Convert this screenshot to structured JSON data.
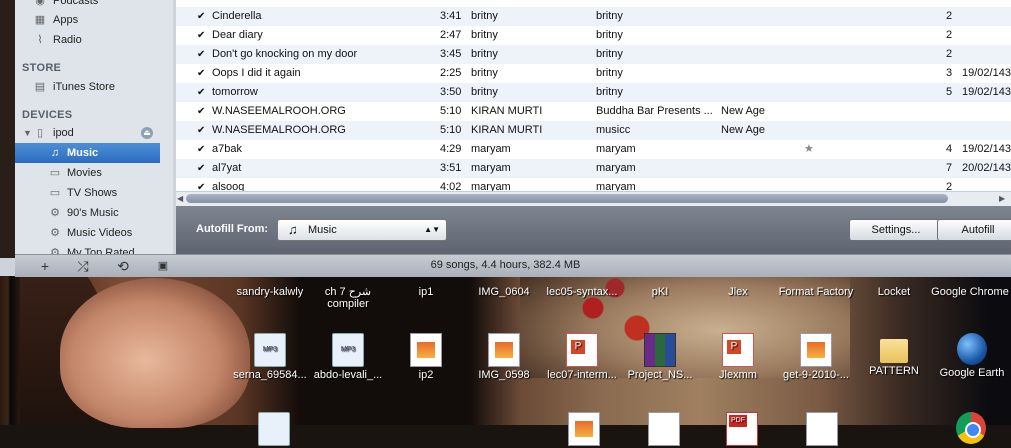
{
  "sidebar": {
    "top_items": [
      {
        "label": "Podcasts",
        "icon": "podcast-icon"
      },
      {
        "label": "Apps",
        "icon": "apps-icon"
      },
      {
        "label": "Radio",
        "icon": "radio-icon"
      }
    ],
    "store_heading": "STORE",
    "store_items": [
      {
        "label": "iTunes Store",
        "icon": "store-icon"
      }
    ],
    "devices_heading": "DEVICES",
    "device": {
      "label": "ipod",
      "icon": "ipod-icon"
    },
    "device_items": [
      {
        "label": "Music",
        "icon": "music-note-icon",
        "selected": true
      },
      {
        "label": "Movies",
        "icon": "movies-icon"
      },
      {
        "label": "TV Shows",
        "icon": "tv-icon"
      },
      {
        "label": "90's Music",
        "icon": "gear-icon"
      },
      {
        "label": "Music Videos",
        "icon": "gear-icon"
      },
      {
        "label": "My Top Rated",
        "icon": "gear-icon"
      }
    ]
  },
  "songs": [
    {
      "checked": "✔",
      "name": "Cinderella",
      "time": "3:41",
      "artist": "britny",
      "album": "britny",
      "genre": "",
      "rating": "",
      "plays": "2",
      "date": ""
    },
    {
      "checked": "✔",
      "name": "Dear diary",
      "time": "2:47",
      "artist": "britny",
      "album": "britny",
      "genre": "",
      "rating": "",
      "plays": "2",
      "date": ""
    },
    {
      "checked": "✔",
      "name": "Don't go knocking on my door",
      "time": "3:45",
      "artist": "britny",
      "album": "britny",
      "genre": "",
      "rating": "",
      "plays": "2",
      "date": ""
    },
    {
      "checked": "✔",
      "name": "Oops I did it again",
      "time": "2:25",
      "artist": "britny",
      "album": "britny",
      "genre": "",
      "rating": "",
      "plays": "3",
      "date": "19/02/143"
    },
    {
      "checked": "✔",
      "name": "tomorrow",
      "time": "3:50",
      "artist": "britny",
      "album": "britny",
      "genre": "",
      "rating": "",
      "plays": "5",
      "date": "19/02/143"
    },
    {
      "checked": "✔",
      "name": "W.NASEEMALROOH.ORG",
      "time": "5:10",
      "artist": "KIRAN MURTI",
      "album": "Buddha Bar Presents ...",
      "genre": "New Age",
      "rating": "",
      "plays": "",
      "date": ""
    },
    {
      "checked": "✔",
      "name": "W.NASEEMALROOH.ORG",
      "time": "5:10",
      "artist": "KIRAN MURTI",
      "album": "musicc",
      "genre": "New Age",
      "rating": "",
      "plays": "",
      "date": ""
    },
    {
      "checked": "✔",
      "name": "a7bak",
      "time": "4:29",
      "artist": "maryam",
      "album": "maryam",
      "genre": "",
      "rating": "★",
      "plays": "4",
      "date": "19/02/143"
    },
    {
      "checked": "✔",
      "name": "al7yat",
      "time": "3:51",
      "artist": "maryam",
      "album": "maryam",
      "genre": "",
      "rating": "",
      "plays": "7",
      "date": "20/02/143"
    },
    {
      "checked": "✔",
      "name": "alsoog",
      "time": "4:02",
      "artist": "maryam",
      "album": "maryam",
      "genre": "",
      "rating": "",
      "plays": "2",
      "date": ""
    }
  ],
  "autofill": {
    "label": "Autofill From:",
    "source": "Music",
    "settings_button": "Settings...",
    "autofill_button": "Autofill"
  },
  "status": {
    "summary": "69 songs, 4.4 hours, 382.4 MB"
  },
  "desktop_icons_row1": [
    "sandry-kalwly",
    "ch 7 شرح compiler",
    "ip1",
    "IMG_0604",
    "lec05-syntax...",
    "pKI",
    "Jlex",
    "Format Factory",
    "Locket",
    "Google Chrome"
  ],
  "desktop_icons_row2": [
    {
      "label": "serna_69584...",
      "type": "mp3"
    },
    {
      "label": "abdo-levali_...",
      "type": "mp3"
    },
    {
      "label": "ip2",
      "type": "img"
    },
    {
      "label": "IMG_0598",
      "type": "img"
    },
    {
      "label": "lec07-interm...",
      "type": "ppt"
    },
    {
      "label": "Project_NS...",
      "type": "rar"
    },
    {
      "label": "Jlexmm",
      "type": "ppt"
    },
    {
      "label": "get-9-2010-...",
      "type": "img"
    },
    {
      "label": "PATTERN",
      "type": "folder"
    },
    {
      "label": "Google Earth",
      "type": "earth"
    }
  ],
  "colors": {
    "selection": "#2b6cc0",
    "autofill_bar": "#6b727c",
    "row_alt": "#eef3fa"
  }
}
